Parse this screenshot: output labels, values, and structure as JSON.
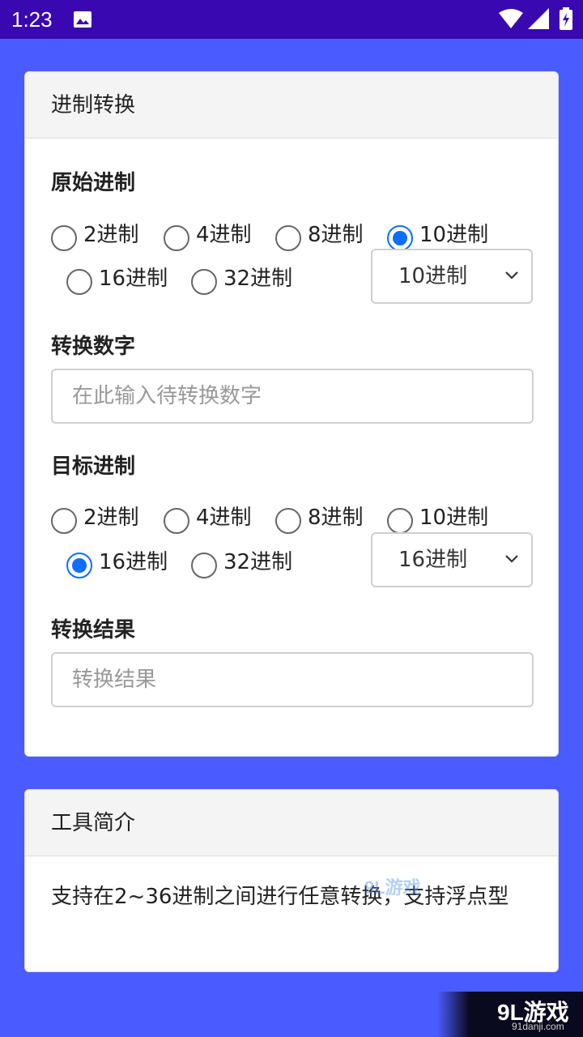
{
  "status_bar": {
    "time": "1:23"
  },
  "converter": {
    "title": "进制转换",
    "source": {
      "heading": "原始进制",
      "options": [
        "2进制",
        "4进制",
        "8进制",
        "10进制",
        "16进制",
        "32进制"
      ],
      "selected": "10进制",
      "dropdown_value": "10进制"
    },
    "number": {
      "heading": "转换数字",
      "placeholder": "在此输入待转换数字",
      "value": ""
    },
    "target": {
      "heading": "目标进制",
      "options": [
        "2进制",
        "4进制",
        "8进制",
        "10进制",
        "16进制",
        "32进制"
      ],
      "selected": "16进制",
      "dropdown_value": "16进制"
    },
    "result": {
      "heading": "转换结果",
      "placeholder": "转换结果",
      "value": ""
    }
  },
  "intro": {
    "title": "工具简介",
    "text": "支持在2~36进制之间进行任意转换，支持浮点型"
  },
  "watermark": {
    "logo": "9L游戏",
    "url": "91danji.com"
  },
  "colors": {
    "background": "#4a5cff",
    "status_bar": "#3a08b0",
    "radio_checked": "#0d6efd"
  },
  "icons": [
    "image-icon",
    "wifi-icon",
    "signal-icon",
    "battery-icon",
    "chevron-down-icon"
  ]
}
